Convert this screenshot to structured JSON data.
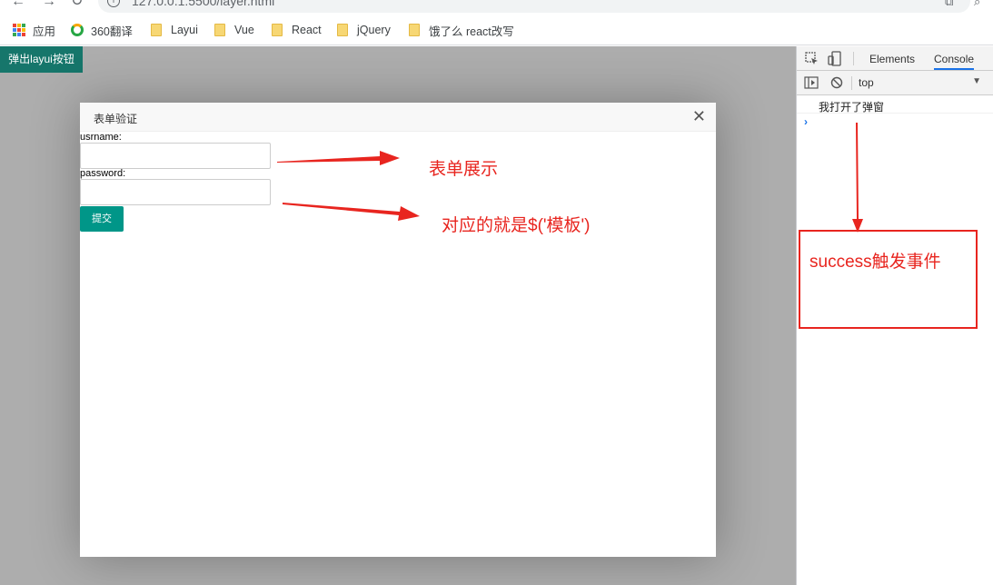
{
  "browser": {
    "url": "127.0.0.1:5500/layer.html",
    "bookmarks": [
      "应用",
      "360翻译",
      "Layui",
      "Vue",
      "React",
      "jQuery",
      "饿了么 react改写"
    ]
  },
  "page": {
    "open_button_label": "弹出layui按钮",
    "dialog": {
      "title": "表单验证",
      "username_label": "usrname:",
      "password_label": "password:",
      "submit_label": "提交"
    },
    "annotations": {
      "form_display": "表单展示",
      "template_note": "对应的就是$('模板')",
      "success_note": "success触发事件"
    }
  },
  "devtools": {
    "tabs": [
      "Elements",
      "Console"
    ],
    "active_tab": "Console",
    "context": "top",
    "log_message": "我打开了弹窗",
    "prompt": "›"
  },
  "colors": {
    "layui_green": "#16766b",
    "submit_green": "#009688",
    "annotation_red": "#e8251f",
    "tab_blue": "#1a73e8"
  }
}
